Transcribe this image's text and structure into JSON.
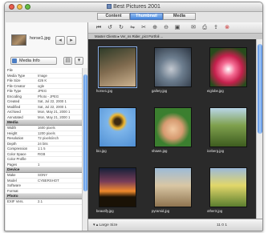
{
  "window": {
    "title": "Best Pictures 2001",
    "traffic_colors": [
      "#e95d4d",
      "#f4c04a",
      "#66bc44"
    ]
  },
  "tabs": [
    {
      "label": "Content"
    },
    {
      "label": "Thumbnail"
    },
    {
      "label": "Media"
    }
  ],
  "inspector": {
    "filename": "horse1.jpg",
    "info_select": "Media Info",
    "sections": [
      {
        "title": "",
        "rows": [
          [
            "File",
            ""
          ],
          [
            "Media Type",
            "Image"
          ],
          [
            "File Size",
            "426 K"
          ],
          [
            "File Creator",
            "ogle"
          ],
          [
            "File Type",
            "JPEG"
          ],
          [
            "Encoding",
            "Photo - JPEG"
          ],
          [
            "Created",
            "Sat, Jul 22, 2000 1"
          ],
          [
            "Modified",
            "Sat, Jul 22, 2000 1"
          ],
          [
            "Archived",
            "Mon, May 21, 2000 1"
          ],
          [
            "Annotated",
            "Mon, May 21, 2000 1"
          ]
        ]
      },
      {
        "title": "Media",
        "rows": [
          [
            "Width",
            "1600 pixels"
          ],
          [
            "Height",
            "1200 pixels"
          ],
          [
            "Resolution",
            "72 pixels/inch"
          ],
          [
            "Depth",
            "24 bits"
          ],
          [
            "Compression",
            "1:1 5"
          ],
          [
            "Color Space",
            "RGB"
          ],
          [
            "Color Profile",
            ""
          ],
          [
            "Pages",
            "1"
          ]
        ]
      },
      {
        "title": "Device",
        "rows": [
          [
            "Make",
            "SONY"
          ],
          [
            "Model",
            "CYBERSHOT"
          ],
          [
            "Software",
            ""
          ],
          [
            "Format",
            ""
          ]
        ]
      },
      {
        "title": "Photo",
        "rows": [
          [
            "EXIF Vers.",
            "2.1"
          ]
        ]
      }
    ]
  },
  "path": "Master Clients ▸ Ver_ns Rider_pict Portfoli ...",
  "thumbnails": [
    {
      "name": "horse1.jpg",
      "icon": "horse-photo",
      "bg": "linear-gradient(160deg,#2e3b28,#7f6a4e 50%,#cdb390)"
    },
    {
      "name": "gallery.jpg",
      "icon": "gallery-photo",
      "bg": "radial-gradient(circle at 45% 55%,#c4c9d1,#6d7e8f 40%,#2c3542)"
    },
    {
      "name": "eiglobe.jpg",
      "icon": "flower-photo",
      "bg": "radial-gradient(circle at 50% 55%,#ffffff,#f56b93 25%,#c4204c 50%,#274b1c 80%)"
    },
    {
      "name": "bio.jpg",
      "icon": "sunflower-photo",
      "bg": "radial-gradient(circle at 50% 35%,#3d2a12 10%,#f0b72e 22%,#7db5ea 32%,#4f8fd4)"
    },
    {
      "name": "shawn.jpg",
      "icon": "boy-photo",
      "bg": "radial-gradient(circle at 50% 55%,#f2c9a1,#d69a70 35%,#3b7f2f 60%)"
    },
    {
      "name": "iceberg.jpg",
      "icon": "grass-photo",
      "bg": "linear-gradient(180deg,#b9d6e8,#7fa04d 45%,#3d5c1f)"
    },
    {
      "name": "beautify.jpg",
      "icon": "sunset-photo",
      "bg": "linear-gradient(180deg,#16213a,#7a3d58 35%,#f08a2c 60%,#1a1206 75%)"
    },
    {
      "name": "pyramid.jpg",
      "icon": "ruins-photo",
      "bg": "linear-gradient(180deg,#9dbbd7,#d9c7a4 45%,#8f7450)"
    },
    {
      "name": "other3.jpg",
      "icon": "field-photo",
      "bg": "linear-gradient(180deg,#9cb9d8,#e2d76a 45%,#5b7e2f)"
    }
  ],
  "status": {
    "text": "▾ ▴ Large Size",
    "count": "11 0 1"
  }
}
